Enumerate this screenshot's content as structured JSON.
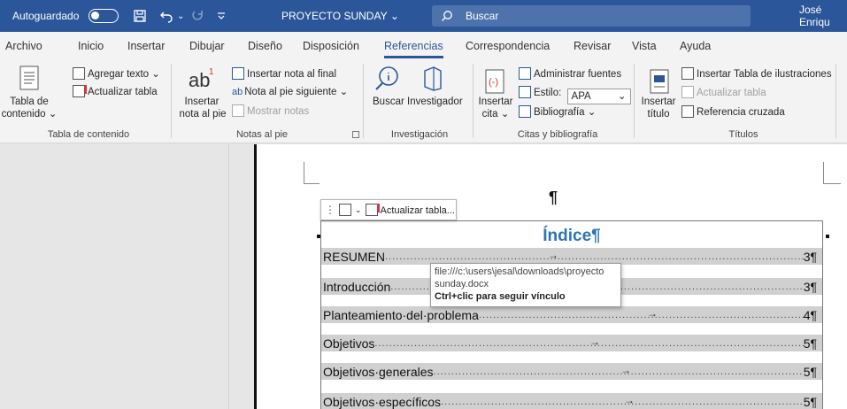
{
  "titlebar": {
    "autosave_label": "Autoguardado",
    "doc_title": "PROYECTO SUNDAY",
    "doc_title_chevron": "⌄",
    "search_placeholder": "Buscar",
    "user_name": "José Enriqu"
  },
  "tabs": [
    "Archivo",
    "Inicio",
    "Insertar",
    "Dibujar",
    "Diseño",
    "Disposición",
    "Referencias",
    "Correspondencia",
    "Revisar",
    "Vista",
    "Ayuda"
  ],
  "active_tab": "Referencias",
  "ribbon": {
    "toc": {
      "big_label_1": "Tabla de",
      "big_label_2": "contenido ⌄",
      "add_text": "Agregar texto ⌄",
      "update_table": "Actualizar tabla",
      "group": "Tabla de contenido"
    },
    "footnotes": {
      "big_label_1": "Insertar",
      "big_label_2": "nota al pie",
      "insert_endnote": "Insertar nota al final",
      "next_footnote": "Nota al pie siguiente  ⌄",
      "show_notes": "Mostrar notas",
      "group": "Notas al pie"
    },
    "research": {
      "search": "Buscar",
      "researcher": "Investigador",
      "group": "Investigación"
    },
    "citations": {
      "big_label_1": "Insertar",
      "big_label_2": "cita ⌄",
      "manage_sources": "Administrar fuentes",
      "style_label": "Estilo:",
      "style_value": "APA",
      "bibliography": "Bibliografía ⌄",
      "group": "Citas y bibliografía"
    },
    "captions": {
      "big_label_1": "Insertar",
      "big_label_2": "título",
      "insert_figures_table": "Insertar Tabla de ilustraciones",
      "update_table": "Actualizar tabla",
      "cross_reference": "Referencia cruzada",
      "group": "Títulos"
    }
  },
  "document": {
    "pilcrow": "¶",
    "field_bar_label": "Actualizar tabla...",
    "toc_title": "Índice",
    "toc_pilcrow": "¶",
    "rows": [
      {
        "label": "RESUMEN",
        "page": "3¶"
      },
      {
        "label": "Introducción",
        "page": "3¶"
      },
      {
        "label": "Planteamiento·del·problema",
        "page": "4¶"
      },
      {
        "label": "Objetivos",
        "page": "5¶"
      },
      {
        "label": "Objetivos·generales",
        "page": "5¶"
      },
      {
        "label": "Objetivos·específicos",
        "page": "5¶"
      }
    ],
    "tooltip": {
      "line1": "file:///c:\\users\\jesal\\downloads\\proyecto",
      "line2": "sunday.docx",
      "line3": "Ctrl+clic para seguir vínculo"
    }
  },
  "colors": {
    "accent": "#2b579a",
    "toc_title": "#2e74b5",
    "toc_highlight": "#d0d0d0"
  }
}
